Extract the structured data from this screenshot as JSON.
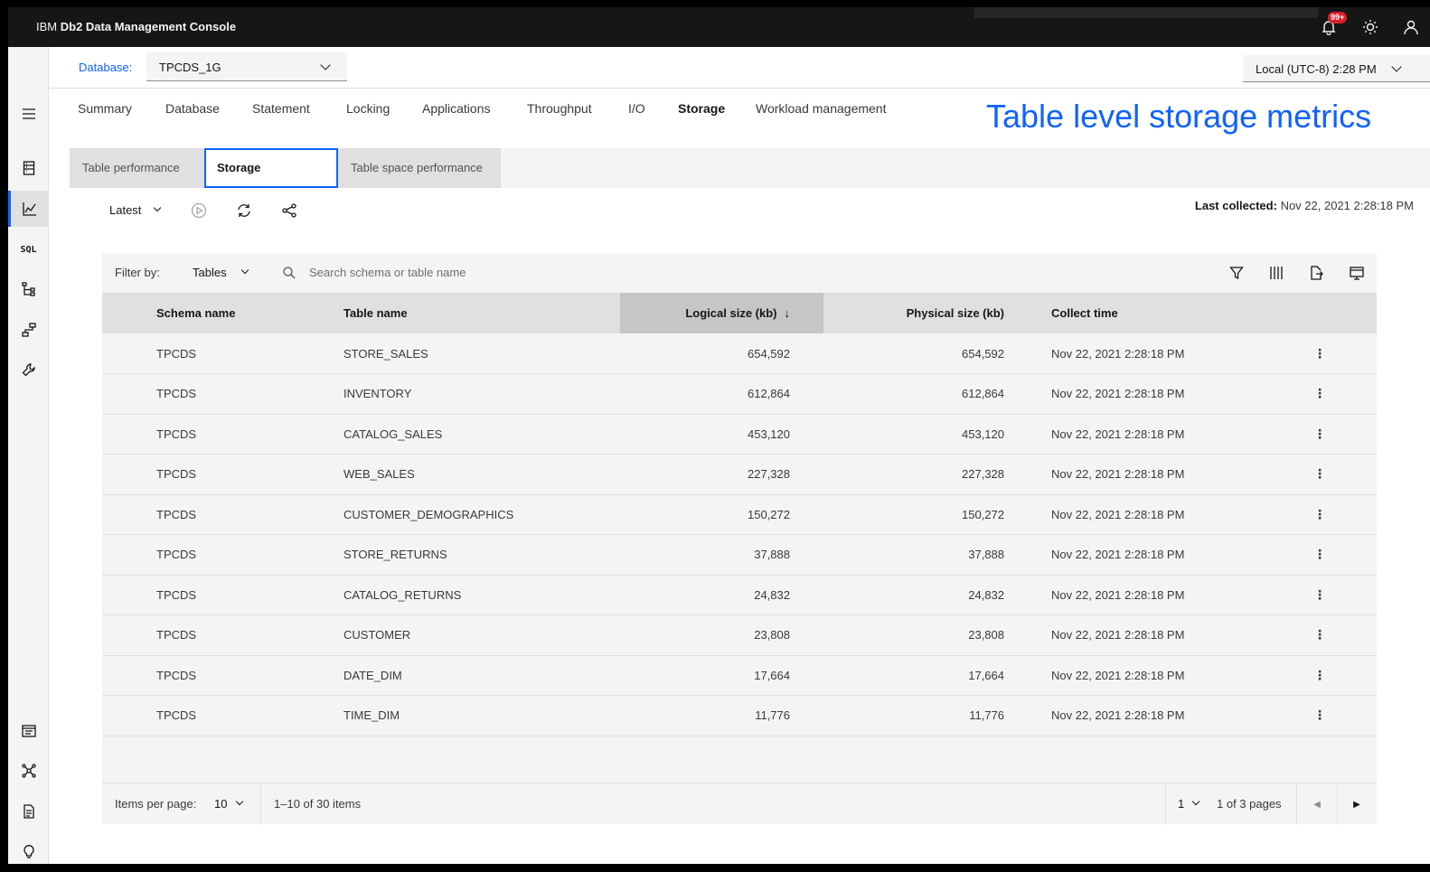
{
  "header": {
    "brand_prefix": "IBM",
    "brand_name": "Db2 Data Management Console",
    "notification_badge": "99+"
  },
  "db_bar": {
    "database_label": "Database:",
    "database_value": "TPCDS_1G",
    "timezone_value": "Local (UTC-8) 2:28 PM"
  },
  "tabs": [
    "Summary",
    "Database",
    "Statement",
    "Locking",
    "Applications",
    "Throughput",
    "I/O",
    "Storage",
    "Workload management"
  ],
  "active_tab": "Storage",
  "annotation": "Table level storage metrics",
  "subtabs": [
    "Table performance",
    "Storage",
    "Table space performance"
  ],
  "active_subtab": "Storage",
  "toolbar": {
    "time_selector": "Latest",
    "last_collected_label": "Last collected:",
    "last_collected_value": "Nov 22, 2021 2:28:18 PM"
  },
  "filter": {
    "label": "Filter by:",
    "type_value": "Tables",
    "search_placeholder": "Search schema or table name"
  },
  "table": {
    "columns": [
      "Schema name",
      "Table name",
      "Logical size (kb)",
      "Physical size (kb)",
      "Collect time"
    ],
    "sorted_column": "Logical size (kb)",
    "rows": [
      {
        "schema": "TPCDS",
        "table": "STORE_SALES",
        "logical": "654,592",
        "physical": "654,592",
        "time": "Nov 22, 2021 2:28:18 PM"
      },
      {
        "schema": "TPCDS",
        "table": "INVENTORY",
        "logical": "612,864",
        "physical": "612,864",
        "time": "Nov 22, 2021 2:28:18 PM"
      },
      {
        "schema": "TPCDS",
        "table": "CATALOG_SALES",
        "logical": "453,120",
        "physical": "453,120",
        "time": "Nov 22, 2021 2:28:18 PM"
      },
      {
        "schema": "TPCDS",
        "table": "WEB_SALES",
        "logical": "227,328",
        "physical": "227,328",
        "time": "Nov 22, 2021 2:28:18 PM"
      },
      {
        "schema": "TPCDS",
        "table": "CUSTOMER_DEMOGRAPHICS",
        "logical": "150,272",
        "physical": "150,272",
        "time": "Nov 22, 2021 2:28:18 PM"
      },
      {
        "schema": "TPCDS",
        "table": "STORE_RETURNS",
        "logical": "37,888",
        "physical": "37,888",
        "time": "Nov 22, 2021 2:28:18 PM"
      },
      {
        "schema": "TPCDS",
        "table": "CATALOG_RETURNS",
        "logical": "24,832",
        "physical": "24,832",
        "time": "Nov 22, 2021 2:28:18 PM"
      },
      {
        "schema": "TPCDS",
        "table": "CUSTOMER",
        "logical": "23,808",
        "physical": "23,808",
        "time": "Nov 22, 2021 2:28:18 PM"
      },
      {
        "schema": "TPCDS",
        "table": "DATE_DIM",
        "logical": "17,664",
        "physical": "17,664",
        "time": "Nov 22, 2021 2:28:18 PM"
      },
      {
        "schema": "TPCDS",
        "table": "TIME_DIM",
        "logical": "11,776",
        "physical": "11,776",
        "time": "Nov 22, 2021 2:28:18 PM"
      }
    ]
  },
  "pagination": {
    "items_per_page_label": "Items per page:",
    "items_per_page_value": "10",
    "range_text": "1–10 of 30 items",
    "page_value": "1",
    "of_pages_text": "1 of 3 pages"
  },
  "colors": {
    "accent": "#0f62fe",
    "header_bg": "#161616",
    "badge": "#da1e28"
  },
  "icons": {
    "header": [
      "notification-icon",
      "theme-icon",
      "user-icon"
    ],
    "leftnav": [
      "menu-icon",
      "database-icon",
      "monitor-chart-icon",
      "sql-icon",
      "tree-icon",
      "flow-icon",
      "wrench-icon",
      "log-icon",
      "network-icon",
      "document-icon",
      "lightbulb-icon"
    ],
    "toolbar": [
      "play-icon",
      "refresh-icon",
      "share-icon"
    ],
    "table_tools": [
      "filter-icon",
      "columns-icon",
      "export-icon",
      "settings-icon"
    ]
  }
}
